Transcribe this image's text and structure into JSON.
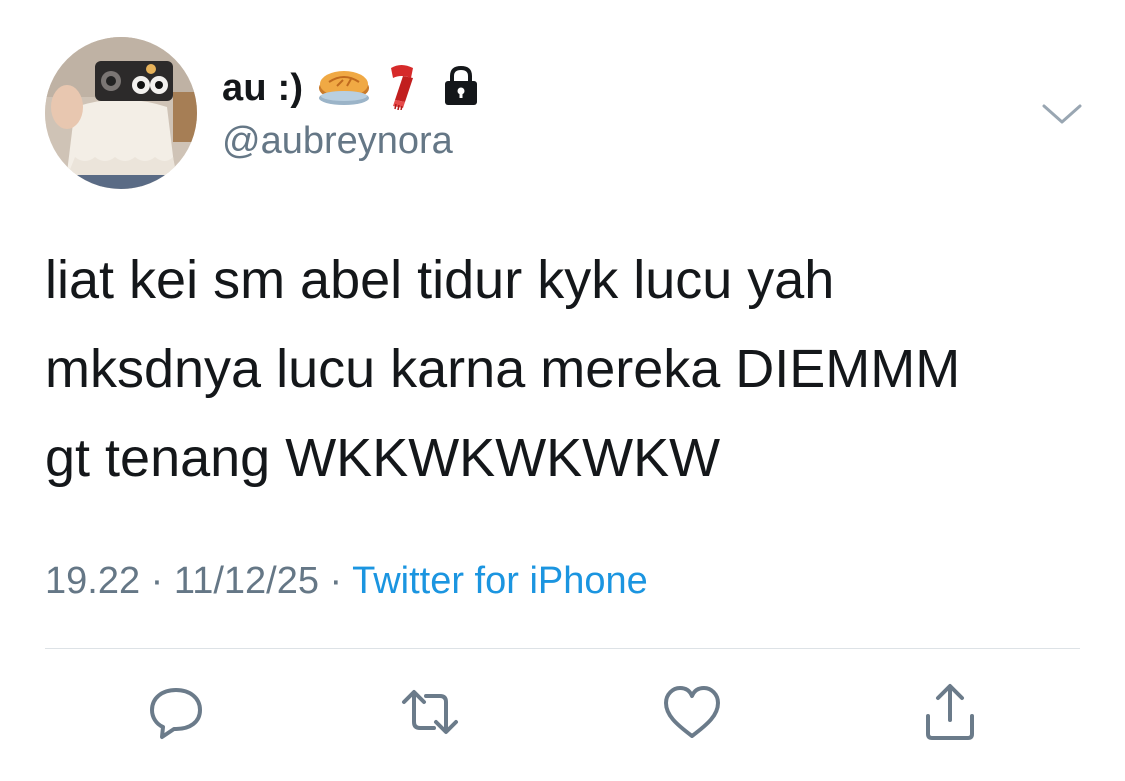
{
  "tweet": {
    "display_name": "au :)",
    "name_emojis": [
      "pie-emoji",
      "scarf-emoji"
    ],
    "protected_icon": "lock-icon",
    "handle": "@aubreynora",
    "menu_icon": "chevron-down-icon",
    "text_lines": [
      "liat kei sm abel tidur kyk lucu yah",
      "mksdnya lucu karna mereka DIEMMM",
      "gt tenang WKKWKWKWKW"
    ],
    "time": "19.22",
    "separator": " · ",
    "date": "11/12/25",
    "source": "Twitter for iPhone"
  },
  "actions": {
    "reply_icon": "reply-icon",
    "retweet_icon": "retweet-icon",
    "like_icon": "heart-icon",
    "share_icon": "share-icon"
  },
  "colors": {
    "text": "#14171a",
    "secondary": "#657786",
    "link": "#1b95e0",
    "icon": "#6b7b8a",
    "divider": "#dde2e6"
  }
}
